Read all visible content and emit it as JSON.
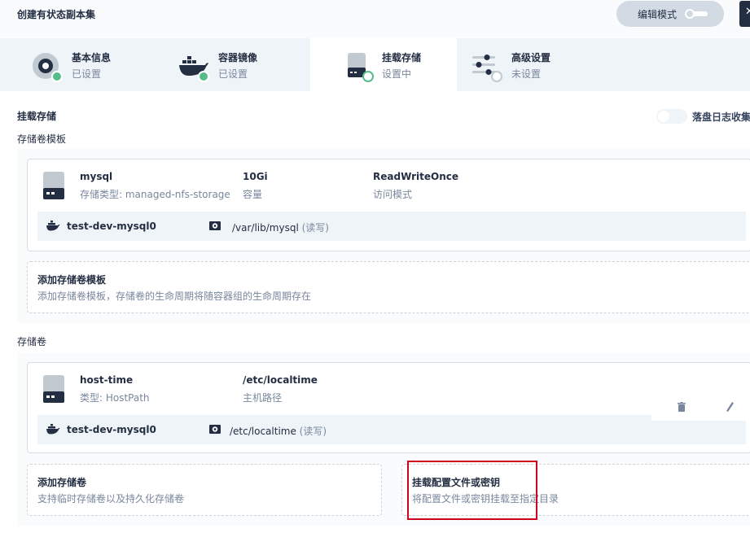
{
  "header": {
    "title": "创建有状态副本集",
    "edit_mode_label": "编辑模式",
    "close_label": "✕"
  },
  "tabs": [
    {
      "title": "基本信息",
      "status": "已设置",
      "icon": "settings-disc-icon"
    },
    {
      "title": "容器镜像",
      "status": "已设置",
      "icon": "docker-icon"
    },
    {
      "title": "挂载存储",
      "status": "设置中",
      "icon": "storage-disk-icon"
    },
    {
      "title": "高级设置",
      "status": "未设置",
      "icon": "sliders-icon"
    }
  ],
  "mount": {
    "title": "挂载存储",
    "disk_log_label": "落盘日志收集",
    "templates_title": "存储卷模板",
    "template": {
      "name": "mysql",
      "type": "存储类型: managed-nfs-storage",
      "capacity": "10Gi",
      "capacity_label": "容量",
      "access_mode": "ReadWriteOnce",
      "access_mode_label": "访问模式",
      "container": "test-dev-mysql0",
      "path": "/var/lib/mysql",
      "rw": "(读写)"
    },
    "add_template": {
      "title": "添加存储卷模板",
      "desc": "添加存储卷模板，存储卷的生命周期将随容器组的生命周期存在"
    },
    "volumes_title": "存储卷",
    "volume": {
      "name": "host-time",
      "type": "类型: HostPath",
      "path_value": "/etc/localtime",
      "path_label": "主机路径",
      "container": "test-dev-mysql0",
      "mount_path": "/etc/localtime",
      "rw": "(读写)"
    },
    "add_volume": {
      "title": "添加存储卷",
      "desc": "支持临时存储卷以及持久化存储卷"
    },
    "mount_config": {
      "title": "挂载配置文件或密钥",
      "desc": "将配置文件或密钥挂载至指定目录"
    }
  },
  "colors": {
    "success": "#55bc8a",
    "dark": "#242e42",
    "muted": "#79879c",
    "highlight": "#d0021b"
  }
}
